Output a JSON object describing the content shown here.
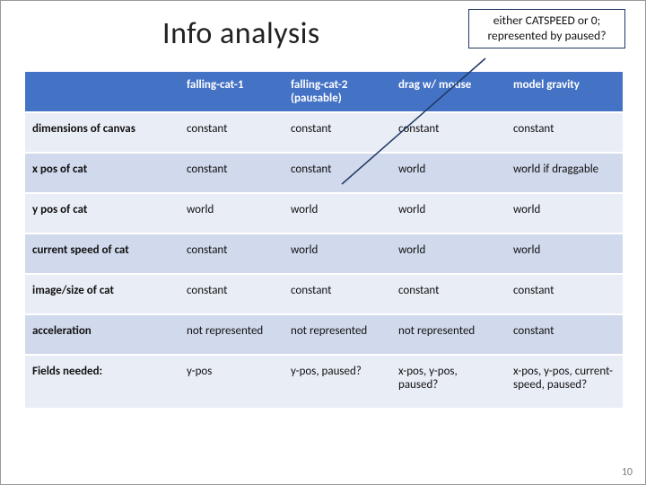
{
  "title": "Info analysis",
  "callout": "either CATSPEED or 0; represented by paused?",
  "columns": [
    "",
    "falling-cat-1",
    "falling-cat-2 (pausable)",
    "drag w/ mouse",
    "model gravity"
  ],
  "rows": [
    {
      "label": "dimensions of canvas",
      "cells": [
        "constant",
        "constant",
        "constant",
        "constant"
      ]
    },
    {
      "label": "x pos of cat",
      "cells": [
        "constant",
        "constant",
        "world",
        "world if draggable"
      ]
    },
    {
      "label": "y pos of cat",
      "cells": [
        "world",
        "world",
        "world",
        "world"
      ]
    },
    {
      "label": "current speed of cat",
      "cells": [
        "constant",
        "world",
        "world",
        "world"
      ]
    },
    {
      "label": "image/size of cat",
      "cells": [
        "constant",
        "constant",
        "constant",
        "constant"
      ]
    },
    {
      "label": "acceleration",
      "cells": [
        "not represented",
        "not represented",
        "not represented",
        "constant"
      ]
    },
    {
      "label": "Fields needed:",
      "cells": [
        "y-pos",
        "y-pos, paused?",
        "x-pos, y-pos, paused?",
        "x-pos, y-pos, current-speed, paused?"
      ]
    }
  ],
  "page_number": "10"
}
